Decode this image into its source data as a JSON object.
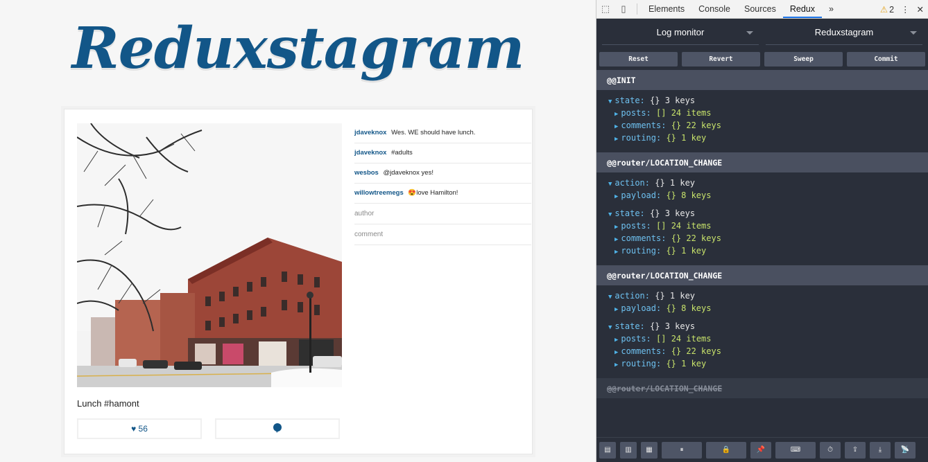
{
  "app": {
    "title": "Reduxstagram",
    "caption": "Lunch #hamont",
    "likes": "♥ 56",
    "comments": [
      {
        "user": "jdaveknox",
        "text": "Wes. WE should have lunch."
      },
      {
        "user": "jdaveknox",
        "text": "#adults"
      },
      {
        "user": "wesbos",
        "text": "@jdaveknox yes!"
      },
      {
        "user": "willowtreemegs",
        "text": "😍love Hamilton!"
      }
    ],
    "form": {
      "author_placeholder": "author",
      "comment_placeholder": "comment"
    }
  },
  "devtools": {
    "tabs": [
      "Elements",
      "Console",
      "Sources",
      "Redux"
    ],
    "active_tab": "Redux",
    "more": "»",
    "warnings": "2",
    "monitor_select": "Log monitor",
    "store_select": "Reduxstagram",
    "actions": [
      "Reset",
      "Revert",
      "Sweep",
      "Commit"
    ],
    "log": {
      "a1_header": "@@INIT",
      "a1_state_key": "state:",
      "a1_state_type": "{} 3 keys",
      "posts_key": "posts:",
      "posts_type": "[] 24 items",
      "comments_key": "comments:",
      "comments_type": "{} 22 keys",
      "routing_key": "routing:",
      "routing_type": "{} 1 key",
      "a2_header": "@@router/LOCATION_CHANGE",
      "action_key": "action:",
      "action_type": "{} 1 key",
      "payload_key": "payload:",
      "payload_type": "{} 8 keys",
      "state_key": "state:",
      "state_type": "{} 3 keys",
      "a3_header": "@@router/LOCATION_CHANGE",
      "a4_header": "@@router/LOCATION_CHANGE"
    }
  }
}
